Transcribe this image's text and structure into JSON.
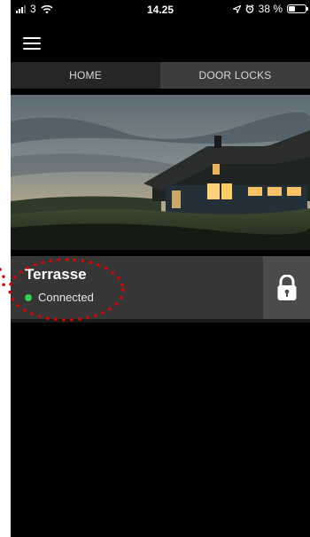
{
  "status_bar": {
    "carrier": "3",
    "time": "14.25",
    "battery_text": "38 %",
    "battery_level": 0.38
  },
  "header": {
    "menu_icon": "hamburger-menu-icon"
  },
  "tabs": [
    {
      "label": "HOME",
      "selected": false
    },
    {
      "label": "DOOR LOCKS",
      "selected": true
    }
  ],
  "hero": {
    "image": "house-at-dusk-photo"
  },
  "locks": [
    {
      "name": "Terrasse",
      "status": "Connected",
      "status_color": "#34d058",
      "lock_icon": "padlock-icon"
    }
  ],
  "colors": {
    "background": "#000000",
    "tab_home_bg": "#262626",
    "tab_active_bg": "#3d3d3d",
    "row_bg": "#363636",
    "lock_button_bg": "#4b4b4b",
    "annotation": "#e00000"
  }
}
